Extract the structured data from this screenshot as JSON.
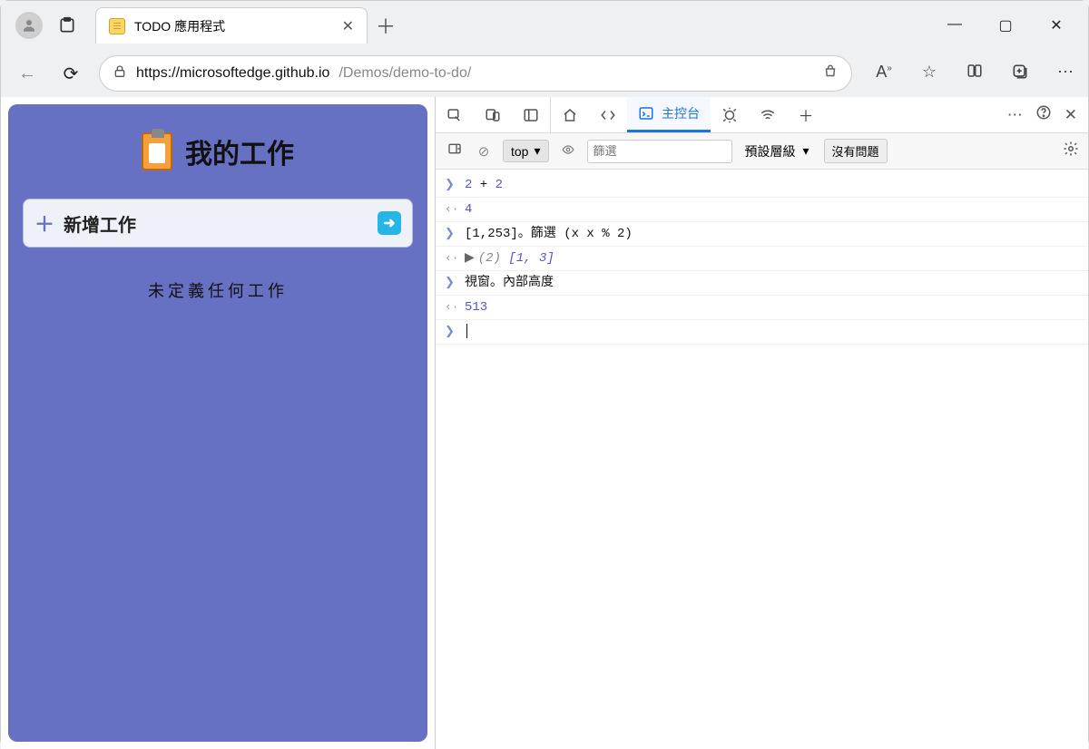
{
  "browser": {
    "tab_title": "TODO 應用程式",
    "url_domain": "https://microsoftedge.github.io",
    "url_path": "/Demos/demo-to-do/"
  },
  "page": {
    "title": "我的工作",
    "add_task_placeholder": "新增工作",
    "empty_message": "未定義任何工作"
  },
  "devtools": {
    "console_tab_label": "主控台",
    "toolbar": {
      "context_label": "top",
      "filter_placeholder": "篩選",
      "level_label": "預設層級",
      "issues_label": "沒有問題"
    },
    "entries": [
      {
        "kind": "input",
        "tokens": [
          [
            "num",
            "2"
          ],
          [
            "op",
            " + "
          ],
          [
            "num",
            "2"
          ]
        ]
      },
      {
        "kind": "output",
        "tokens": [
          [
            "num",
            "4"
          ]
        ]
      },
      {
        "kind": "input",
        "tokens": [
          [
            "txt",
            "[1,253]。篩選 (x x % 2)"
          ]
        ]
      },
      {
        "kind": "output",
        "expandable": true,
        "tokens": [
          [
            "count",
            "(2) "
          ],
          [
            "arr",
            "[1, 3]"
          ]
        ]
      },
      {
        "kind": "input",
        "tokens": [
          [
            "txt",
            "視窗。內部高度"
          ]
        ]
      },
      {
        "kind": "output",
        "tokens": [
          [
            "num",
            "513"
          ]
        ]
      }
    ]
  }
}
